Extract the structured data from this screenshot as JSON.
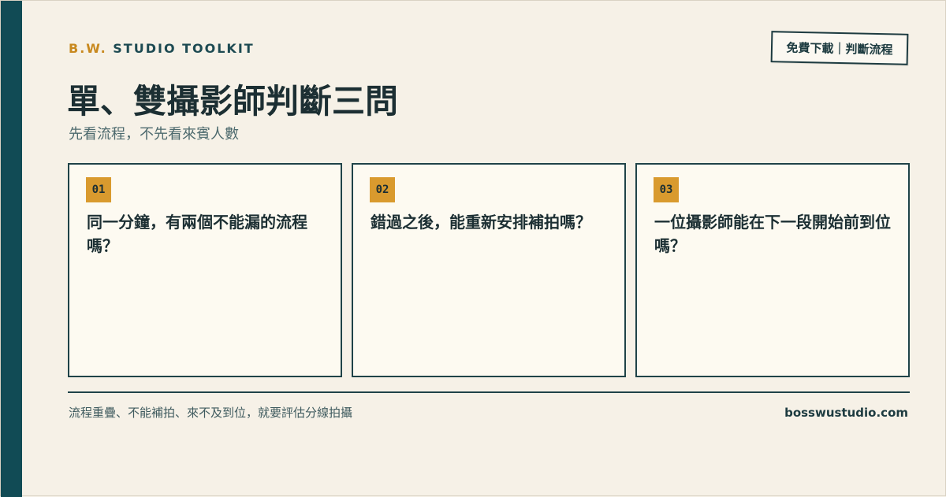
{
  "brand": {
    "accent": "B.W.",
    "name": "STUDIO TOOLKIT"
  },
  "badge": {
    "label": "免費下載｜判斷流程"
  },
  "header": {
    "title": "單、雙攝影師判斷三問",
    "subtitle": "先看流程，不先看來賓人數"
  },
  "cards": [
    {
      "number": "01",
      "text": "同一分鐘，有兩個不能漏的流程嗎？"
    },
    {
      "number": "02",
      "text": "錯過之後，能重新安排補拍嗎？"
    },
    {
      "number": "03",
      "text": "一位攝影師能在下一段開始前到位嗎？"
    }
  ],
  "footer": {
    "note": "流程重疊、不能補拍、來不及到位，就要評估分線拍攝",
    "site": "bosswustudio.com"
  },
  "colors": {
    "side_bar": "#114b55",
    "accent": "#c8891f",
    "number_badge": "#d99a2e",
    "background": "#f6f1e7",
    "card_background": "#fdfaf1",
    "ink": "#1c2f33"
  }
}
